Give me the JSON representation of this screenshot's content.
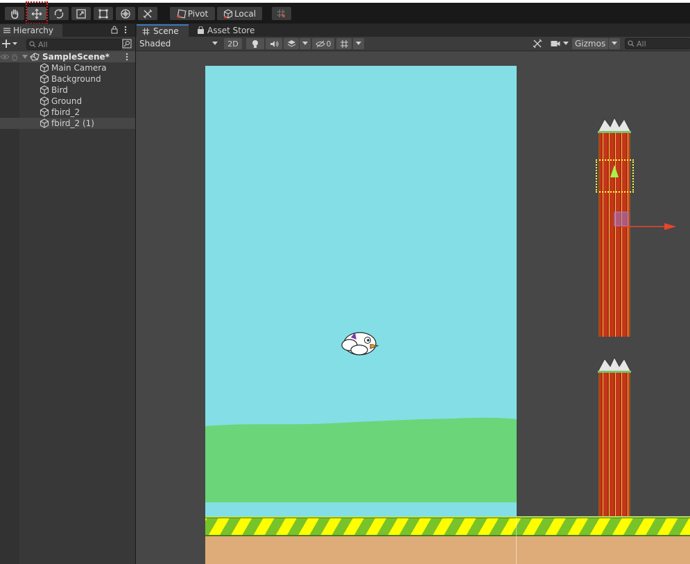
{
  "toolbar": {
    "tools": [
      "hand-tool",
      "move-tool",
      "rotate-tool",
      "scale-tool",
      "rect-tool",
      "transform-tool",
      "custom-tool"
    ],
    "active_tool": "move-tool",
    "pivot_label": "Pivot",
    "local_label": "Local"
  },
  "hierarchy": {
    "tab_label": "Hierarchy",
    "search_placeholder": "All",
    "scene_name": "SampleScene*",
    "items": [
      {
        "label": "Main Camera"
      },
      {
        "label": "Background"
      },
      {
        "label": "Bird"
      },
      {
        "label": "Ground"
      },
      {
        "label": "fbird_2"
      },
      {
        "label": "fbird_2 (1)",
        "selected": true
      }
    ]
  },
  "scene": {
    "tabs": [
      {
        "label": "Scene",
        "active": true
      },
      {
        "label": "Asset Store",
        "active": false
      }
    ],
    "draw_mode": "Shaded",
    "mode_2d": "2D",
    "hidden_count": "0",
    "gizmos_label": "Gizmos",
    "search_placeholder": "All"
  },
  "colors": {
    "sky": "#83dfe5",
    "grass": "#6bd57a",
    "pipe": "#c2361a",
    "ground_stripe_a": "#ffff00",
    "ground_stripe_b": "#79c32a",
    "dirt": "#deac78",
    "selection_marker": "#e01818",
    "gizmo_y": "#a6f34a",
    "gizmo_x": "#e8452c"
  }
}
